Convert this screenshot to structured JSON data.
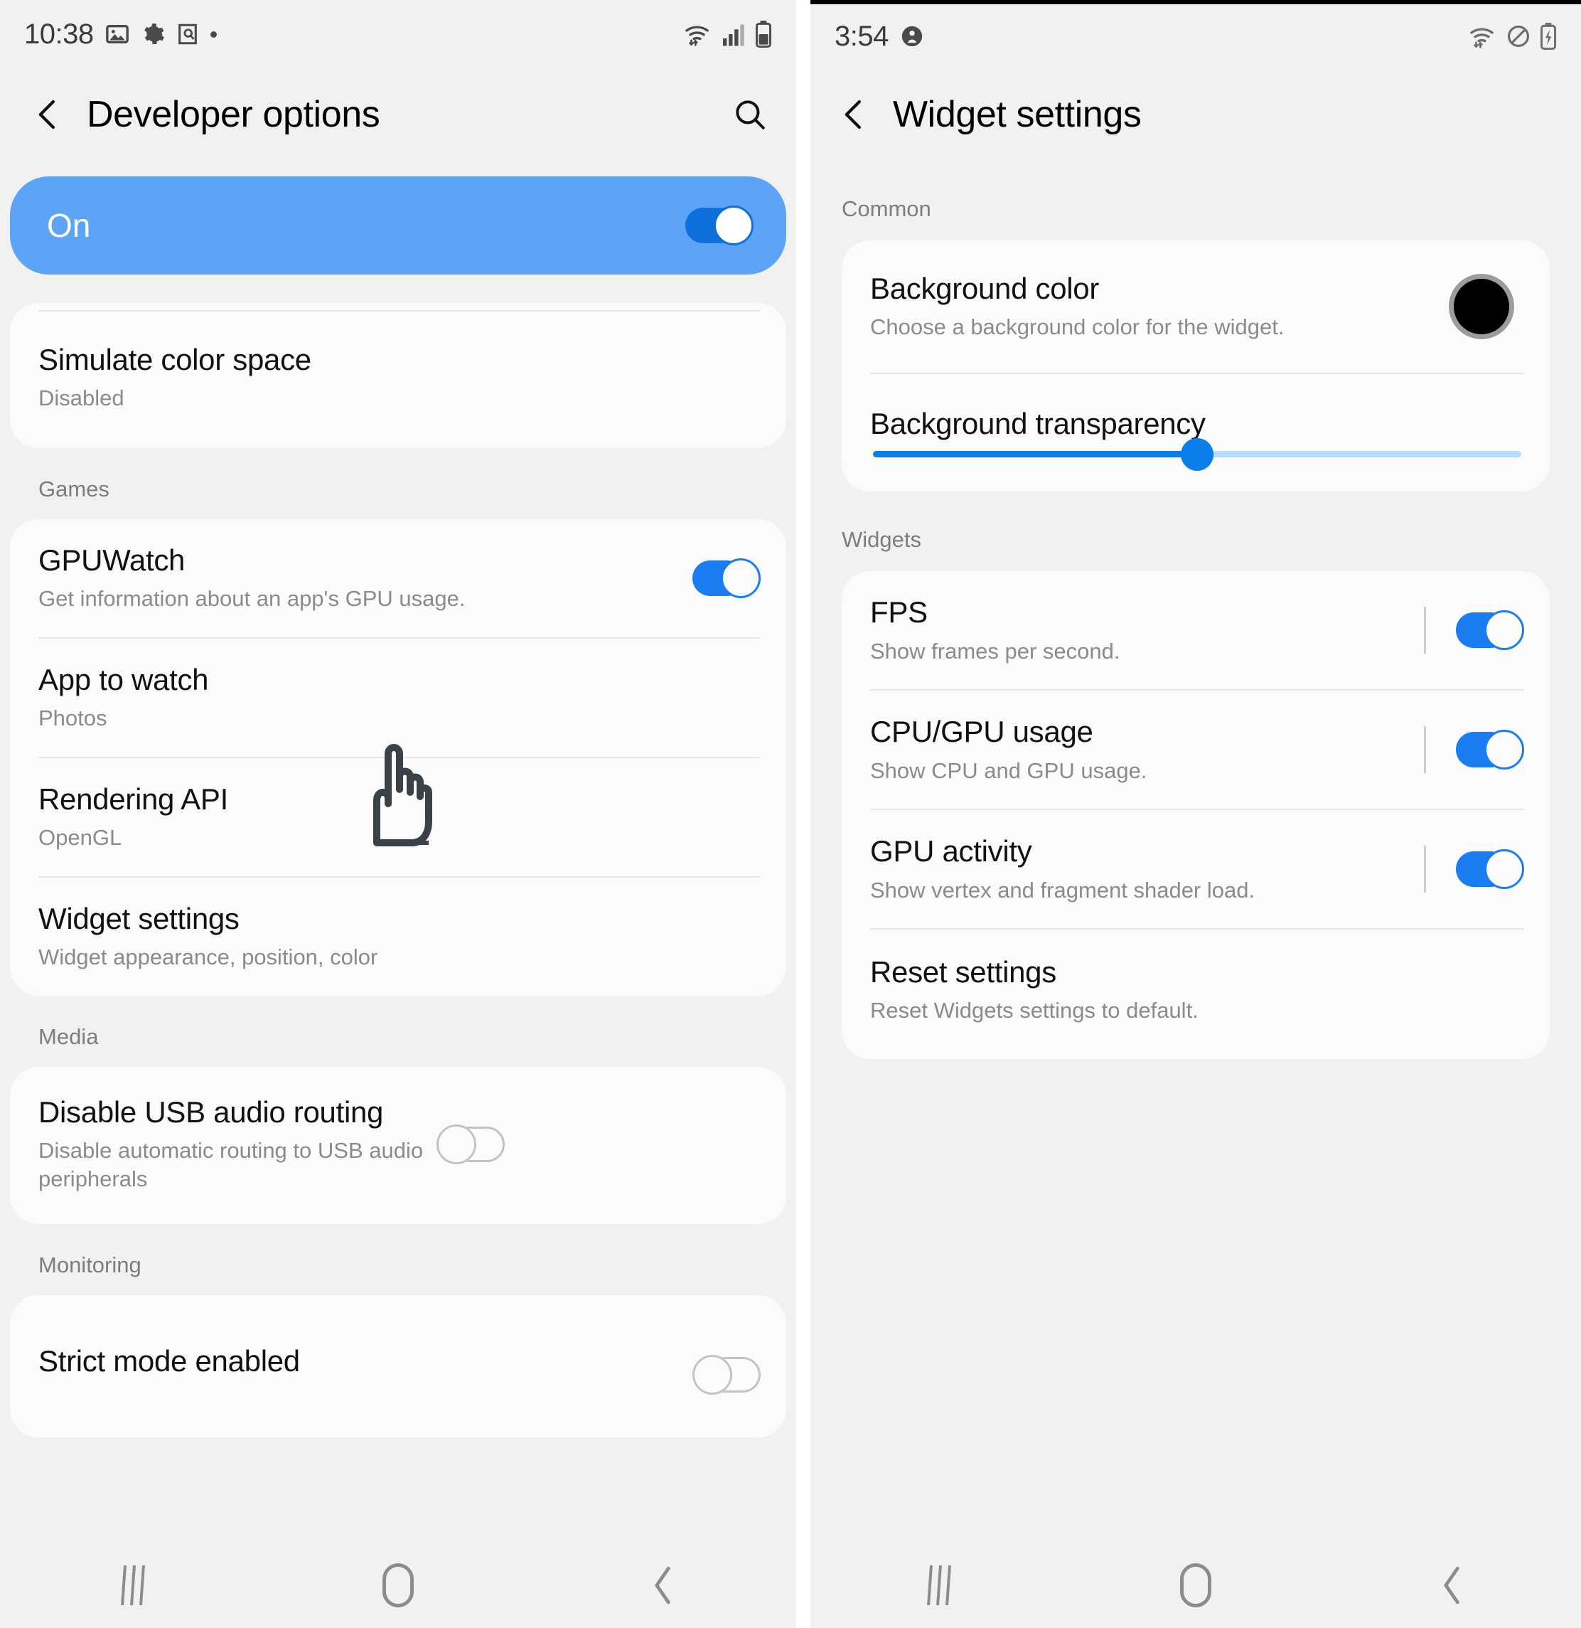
{
  "left_screen": {
    "status_bar": {
      "time": "10:38",
      "icons": [
        "image-icon",
        "gear-icon",
        "screenshot-icon",
        "dot-icon"
      ],
      "right_icons": [
        "wifi-icon",
        "signal-icon",
        "battery-icon"
      ]
    },
    "title": "Developer options",
    "back_icon": "back-chevron-icon",
    "search_icon": "search-icon",
    "master_banner": {
      "label": "On",
      "toggle": "on"
    },
    "groups": [
      {
        "header": "",
        "rows": [
          {
            "title": "Simulate color space",
            "subtitle": "Disabled",
            "control": "none"
          }
        ]
      },
      {
        "header": "Games",
        "rows": [
          {
            "title": "GPUWatch",
            "subtitle": "Get information about an app's GPU usage.",
            "control": "toggle-on"
          },
          {
            "title": "App to watch",
            "subtitle": "Photos",
            "control": "none"
          },
          {
            "title": "Rendering API",
            "subtitle": "OpenGL",
            "control": "none"
          },
          {
            "title": "Widget settings",
            "subtitle": "Widget appearance, position, color",
            "control": "none"
          }
        ]
      },
      {
        "header": "Media",
        "rows": [
          {
            "title": "Disable USB audio routing",
            "subtitle": "Disable automatic routing to USB audio peripherals",
            "control": "toggle-off"
          }
        ]
      },
      {
        "header": "Monitoring",
        "rows": [
          {
            "title": "Strict mode enabled",
            "subtitle": "",
            "control": "toggle-off"
          }
        ]
      }
    ],
    "cursor": "pointing-hand-cursor",
    "nav": {
      "recents": "recents-icon",
      "home": "home-icon",
      "back": "back-icon"
    }
  },
  "right_screen": {
    "status_bar": {
      "time": "3:54",
      "icons": [
        "person-icon"
      ],
      "right_icons": [
        "wifi-icon",
        "do-not-disturb-icon",
        "battery-charging-icon"
      ]
    },
    "title": "Widget settings",
    "back_icon": "back-chevron-icon",
    "groups": [
      {
        "header": "Common",
        "rows": [
          {
            "title": "Background color",
            "subtitle": "Choose a background color for the widget.",
            "control": "color-swatch",
            "swatch_color": "#000000"
          },
          {
            "title": "Background transparency",
            "subtitle": "",
            "control": "slider",
            "slider_percent": 50
          }
        ]
      },
      {
        "header": "Widgets",
        "rows": [
          {
            "title": "FPS",
            "subtitle": "Show frames per second.",
            "control": "toggle-on"
          },
          {
            "title": "CPU/GPU usage",
            "subtitle": "Show CPU and GPU usage.",
            "control": "toggle-on"
          },
          {
            "title": "GPU activity",
            "subtitle": "Show vertex and fragment shader load.",
            "control": "toggle-on"
          },
          {
            "title": "Reset settings",
            "subtitle": "Reset Widgets settings to default.",
            "control": "none"
          }
        ]
      }
    ],
    "nav": {
      "recents": "recents-icon",
      "home": "home-icon",
      "back": "back-icon"
    }
  },
  "colors": {
    "accent_blue": "#1a7ef2",
    "banner_blue": "#5ba4f7",
    "slider_blue": "#0b7eeb",
    "slider_track": "#b8dcfb",
    "page_bg": "#f1f1f0",
    "card_bg": "#fbfbfb"
  }
}
